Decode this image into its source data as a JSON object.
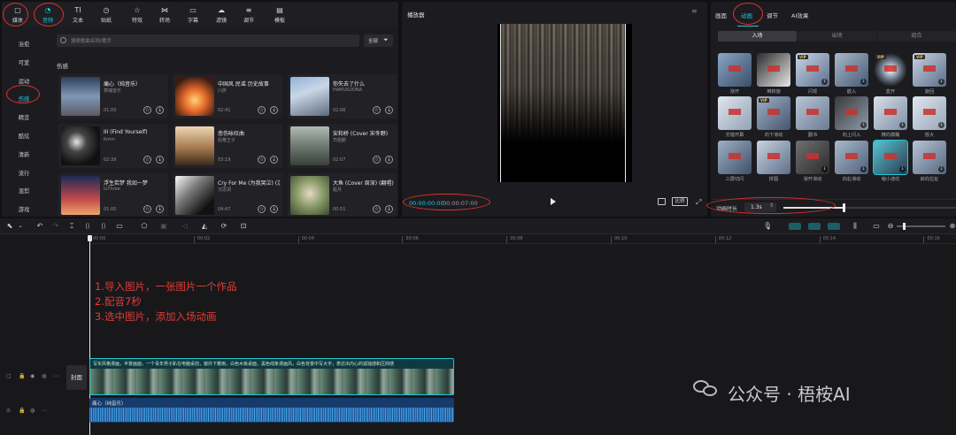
{
  "toolbar": {
    "items": [
      {
        "label": "媒体",
        "icon": "media-icon"
      },
      {
        "label": "音频",
        "icon": "audio-icon"
      },
      {
        "label": "文本",
        "icon": "text-icon"
      },
      {
        "label": "贴纸",
        "icon": "sticker-icon"
      },
      {
        "label": "特效",
        "icon": "effects-icon"
      },
      {
        "label": "转场",
        "icon": "transition-icon"
      },
      {
        "label": "字幕",
        "icon": "subtitle-icon"
      },
      {
        "label": "滤镜",
        "icon": "filter-icon"
      },
      {
        "label": "调节",
        "icon": "adjust-icon"
      },
      {
        "label": "模板",
        "icon": "template-icon"
      }
    ]
  },
  "sidebar": {
    "items": [
      "治愈",
      "可爱",
      "运动",
      "伤感",
      "精览",
      "酷炫",
      "清新",
      "流行",
      "混剪",
      "游戏"
    ],
    "active_index": 3
  },
  "search": {
    "placeholder": "搜索歌曲名称/歌手",
    "filter_label": "全部"
  },
  "music": {
    "section_title": "伤感",
    "tracks": [
      {
        "title": "痛心（纯音乐）",
        "artist": "萧瑞音乐",
        "duration": "01:00"
      },
      {
        "title": "中国风 民谣 历史故事",
        "artist": "川彦",
        "duration": "02:41"
      },
      {
        "title": "你失去了什么",
        "artist": "HAMUSUONA",
        "duration": "02:06"
      },
      {
        "title": "III (Find Yourself)",
        "artist": "Kmm",
        "duration": "02:39"
      },
      {
        "title": "悲伤咏叹曲",
        "artist": "伯格王子",
        "duration": "03:19"
      },
      {
        "title": "安和桥 (Cover 宋冬野)",
        "artist": "司祖鹏",
        "duration": "02:07"
      },
      {
        "title": "浮生若梦 我如一梦",
        "artist": "luThree",
        "duration": "01:00"
      },
      {
        "title": "Cry For Me (为我哭泣) (沉思调 Remix)",
        "artist": "沉思调",
        "duration": "04:47"
      },
      {
        "title": "大鱼 (Cover 周深) (翻唱)",
        "artist": "瓶月",
        "duration": "00:51"
      }
    ]
  },
  "player": {
    "title": "播放器",
    "current_time": "00:00:00:00",
    "total_time": "00:00:07:00",
    "ratio_label": "比例"
  },
  "inspector": {
    "tabs": [
      "画面",
      "动画",
      "调节",
      "AI效果"
    ],
    "active_tab": 1,
    "subtabs": [
      "入场",
      "出场",
      "组合"
    ],
    "active_subtab": 0,
    "animations": [
      {
        "label": "渐开",
        "vip": false,
        "dl": false
      },
      {
        "label": "倒转旋",
        "vip": false,
        "dl": false
      },
      {
        "label": "闪现",
        "vip": true,
        "dl": true
      },
      {
        "label": "戳入",
        "vip": false,
        "dl": true
      },
      {
        "label": "盒开",
        "vip": true,
        "dl": false
      },
      {
        "label": "旋回",
        "vip": true,
        "dl": true
      },
      {
        "label": "交错开幕",
        "vip": false,
        "dl": false
      },
      {
        "label": "向下滑动",
        "vip": true,
        "dl": false
      },
      {
        "label": "翻书",
        "vip": false,
        "dl": false
      },
      {
        "label": "向上闪入",
        "vip": false,
        "dl": true
      },
      {
        "label": "横向模糊",
        "vip": false,
        "dl": true
      },
      {
        "label": "放大",
        "vip": false,
        "dl": true
      },
      {
        "label": "三屏切闪",
        "vip": false,
        "dl": false
      },
      {
        "label": "拼图",
        "vip": false,
        "dl": false
      },
      {
        "label": "渐开滑动",
        "vip": false,
        "dl": true
      },
      {
        "label": "向右滑动",
        "vip": false,
        "dl": true
      },
      {
        "label": "缩小波纹",
        "vip": false,
        "dl": true
      },
      {
        "label": "斜向拉扯",
        "vip": false,
        "dl": true
      }
    ],
    "duration_label": "动画时长",
    "duration_value": "1.3s",
    "slider_fraction": 0.35
  },
  "timeline": {
    "ruler": [
      "00:00",
      "00:02",
      "00:04",
      "00:06",
      "00:08",
      "00:10",
      "00:12",
      "00:14",
      "00:16"
    ],
    "cover_label": "封面",
    "video_caption": "写实风格漫画，半景画面，一个青年男子趴在电脑桌前，窗外下着雨，白色木板桌面，黑色线条漫画风，白色背景中写大字，表达出内心的孤独感和压抑感",
    "audio_label": "痛心（纯音乐）"
  },
  "annotations": {
    "lines": [
      "1.导入图片，一张图片一个作品",
      "2.配音7秒",
      "3.选中图片，添加入场动画"
    ]
  },
  "watermark": {
    "text": "公众号 · 梧桉AI"
  },
  "colors": {
    "accent": "#1fc8d6",
    "annotation": "#e23b34"
  }
}
